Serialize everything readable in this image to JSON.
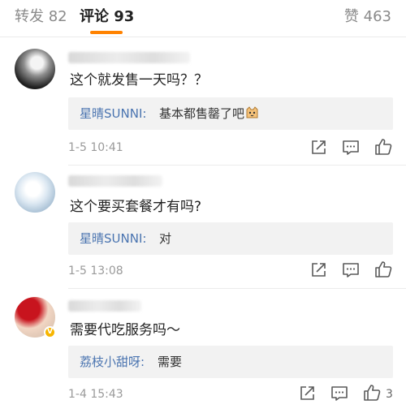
{
  "tabs": {
    "repost": {
      "label": "转发",
      "count": "82"
    },
    "comment": {
      "label": "评论",
      "count": "93"
    },
    "like": {
      "label": "赞",
      "count": "463"
    }
  },
  "colors": {
    "accent": "#ff8200",
    "reply_author": "#4a74b0",
    "vip_badge": "#f7b500"
  },
  "comments": [
    {
      "text": "这个就发售一天吗？？",
      "reply": {
        "author": "星晴SUNNI:",
        "text": "基本都售罄了吧",
        "emoji": "cat-face-emoji"
      },
      "time": "1-5 10:41",
      "likes": ""
    },
    {
      "text": "这个要买套餐才有吗?",
      "reply": {
        "author": "星晴SUNNI:",
        "text": "对"
      },
      "time": "1-5 13:08",
      "likes": ""
    },
    {
      "text": "需要代吃服务吗～",
      "reply": {
        "author": "荔枝小甜呀:",
        "text": "需要"
      },
      "time": "1-4 15:43",
      "likes": "3"
    }
  ],
  "icons": {
    "share": "share-icon",
    "comment": "comment-icon",
    "like": "like-icon",
    "verified": "verified-badge-icon"
  }
}
